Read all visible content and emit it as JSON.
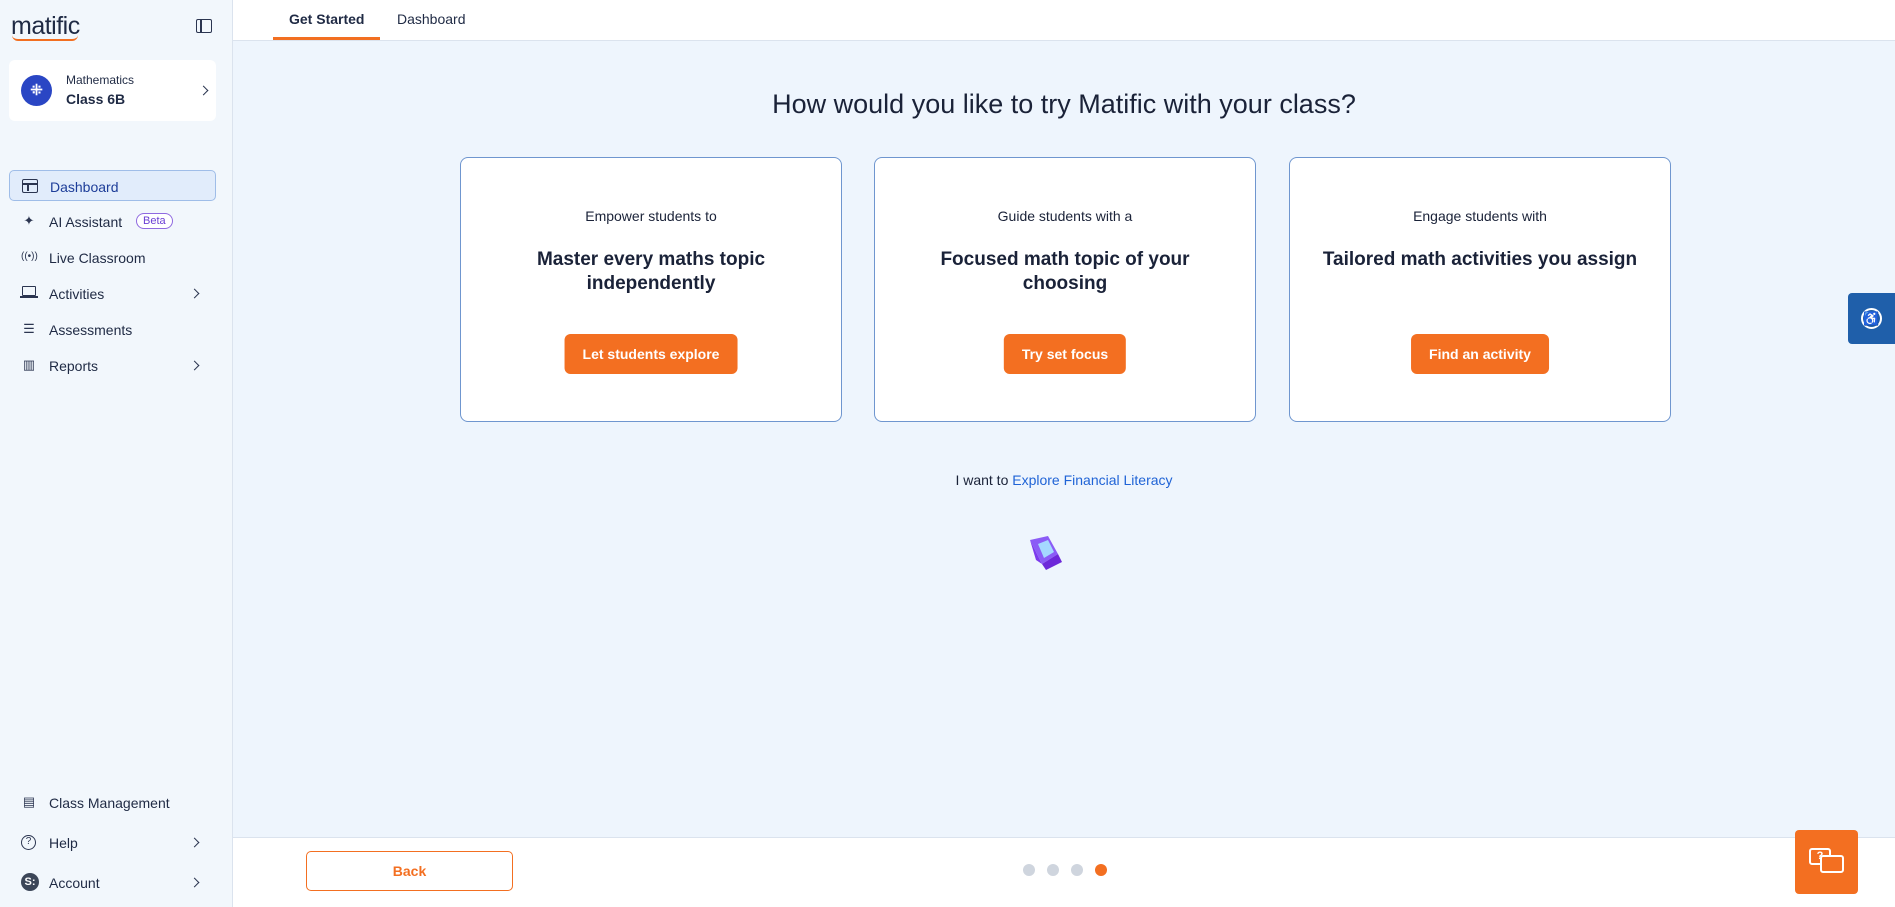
{
  "sidebar": {
    "logo": "matific",
    "class_card": {
      "subject": "Mathematics",
      "name": "Class 6B",
      "avatar_icon": "grid-icon"
    },
    "items": [
      {
        "label": "Dashboard",
        "icon": "dashboard-icon",
        "active": true
      },
      {
        "label": "AI Assistant",
        "icon": "sparkle-icon",
        "badge": "Beta"
      },
      {
        "label": "Live Classroom",
        "icon": "broadcast-icon"
      },
      {
        "label": "Activities",
        "icon": "laptop-icon",
        "has_submenu": true
      },
      {
        "label": "Assessments",
        "icon": "checklist-icon"
      },
      {
        "label": "Reports",
        "icon": "bar-chart-icon",
        "has_submenu": true
      }
    ],
    "bottom_items": [
      {
        "label": "Class Management",
        "icon": "class-management-icon"
      },
      {
        "label": "Help",
        "icon": "help-icon",
        "has_submenu": true
      },
      {
        "label": "Account",
        "icon": "account-avatar",
        "avatar_letter": "S:",
        "has_submenu": true
      }
    ]
  },
  "tabs": [
    {
      "label": "Get Started",
      "active": true
    },
    {
      "label": "Dashboard",
      "active": false
    }
  ],
  "main": {
    "headline": "How would you like to try Matific with your class?",
    "cards": [
      {
        "lead": "Empower students to",
        "title": "Master every maths topic independently",
        "button": "Let students explore"
      },
      {
        "lead": "Guide students with a",
        "title": "Focused math topic of your choosing",
        "button": "Try set focus"
      },
      {
        "lead": "Engage students with",
        "title": "Tailored math activities you assign",
        "button": "Find an activity"
      }
    ],
    "financial_literacy": {
      "prefix": "I want to",
      "link": "Explore Financial Literacy"
    }
  },
  "footer": {
    "back_label": "Back",
    "steps": {
      "total": 4,
      "current": 4
    }
  },
  "colors": {
    "accent": "#f36f21",
    "primary_blue": "#2a46c4",
    "link_blue": "#1f63d6",
    "background": "#eef5fd"
  },
  "chat_icon_glyph": "?",
  "a11y_icon": "accessibility-icon"
}
